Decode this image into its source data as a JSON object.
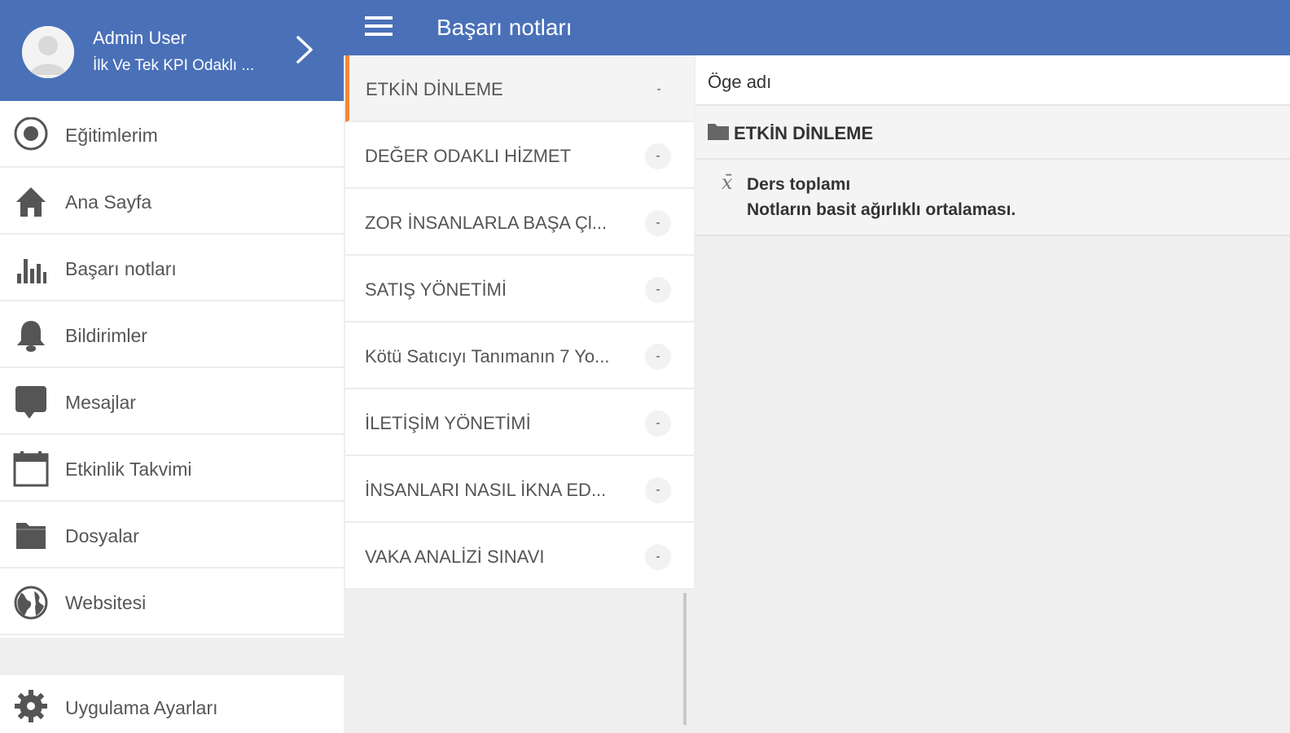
{
  "profile": {
    "name": "Admin User",
    "subtitle": "İlk Ve Tek KPI Odaklı ..."
  },
  "sidebar": {
    "items": [
      {
        "label": "Eğitimlerim",
        "icon": "target-icon"
      },
      {
        "label": "Ana Sayfa",
        "icon": "home-icon"
      },
      {
        "label": "Başarı notları",
        "icon": "bar-chart-icon"
      },
      {
        "label": "Bildirimler",
        "icon": "bell-icon"
      },
      {
        "label": "Mesajlar",
        "icon": "message-icon"
      },
      {
        "label": "Etkinlik Takvimi",
        "icon": "calendar-icon"
      },
      {
        "label": "Dosyalar",
        "icon": "folder-icon"
      },
      {
        "label": "Websitesi",
        "icon": "globe-icon"
      }
    ],
    "settings_label": "Uygulama Ayarları"
  },
  "topbar": {
    "title": "Başarı notları"
  },
  "courses": {
    "items": [
      {
        "label": "ETKİN DİNLEME",
        "value": "-"
      },
      {
        "label": "DEĞER ODAKLI HİZMET",
        "value": "-"
      },
      {
        "label": "ZOR İNSANLARLA BAŞA Çl...",
        "value": "-"
      },
      {
        "label": "SATIŞ YÖNETİMİ",
        "value": "-"
      },
      {
        "label": "Kötü Satıcıyı Tanımanın 7 Yo...",
        "value": "-"
      },
      {
        "label": "İLETİŞİM YÖNETİMİ",
        "value": "-"
      },
      {
        "label": "İNSANLARI NASIL İKNA ED...",
        "value": "-"
      },
      {
        "label": "VAKA ANALİZİ SINAVI",
        "value": "-"
      }
    ]
  },
  "detail": {
    "header": "Öge adı",
    "folder_label": "ETKİN DİNLEME",
    "aggregate_title": "Ders toplamı",
    "aggregate_desc": "Notların basit ağırlıklı ortalaması."
  },
  "colors": {
    "primary": "#4a70b8",
    "accent": "#f5883a"
  }
}
